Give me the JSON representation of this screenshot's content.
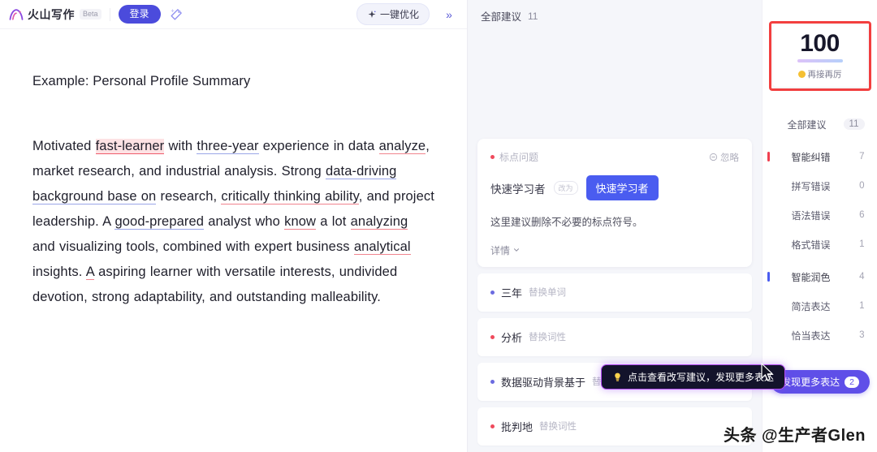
{
  "header": {
    "logo_text": "火山写作",
    "beta_label": "Beta",
    "login_label": "登录",
    "wand_icon": "magic-wand-icon",
    "optimize_label": "一键优化",
    "optimize_icon": "sparkle-icon",
    "collapse_label": "»"
  },
  "editor": {
    "title": "Example: Personal Profile Summary",
    "paragraph_segments": [
      {
        "text": "Motivated ",
        "mark": "none"
      },
      {
        "text": "fast-learner",
        "mark": "error-highlight"
      },
      {
        "text": " with ",
        "mark": "none"
      },
      {
        "text": "three-year",
        "mark": "polish"
      },
      {
        "text": " experience in data ",
        "mark": "none"
      },
      {
        "text": "analyze",
        "mark": "error"
      },
      {
        "text": ", market research, and industrial analysis. Strong ",
        "mark": "none"
      },
      {
        "text": "data-driving background base on",
        "mark": "polish"
      },
      {
        "text": " research, ",
        "mark": "none"
      },
      {
        "text": "critically thinking ability",
        "mark": "error"
      },
      {
        "text": ", and project leadership. A ",
        "mark": "none"
      },
      {
        "text": "good-prepared",
        "mark": "polish"
      },
      {
        "text": " analyst who ",
        "mark": "none"
      },
      {
        "text": "know",
        "mark": "error"
      },
      {
        "text": " a lot ",
        "mark": "none"
      },
      {
        "text": "analyzing",
        "mark": "error"
      },
      {
        "text": " and visualizing tools, combined with expert business ",
        "mark": "none"
      },
      {
        "text": "analytical",
        "mark": "error"
      },
      {
        "text": " insights. ",
        "mark": "none"
      },
      {
        "text": "A",
        "mark": "error"
      },
      {
        "text": " aspiring learner with versatile interests, undivided devotion, strong adaptability, and outstanding malleability.",
        "mark": "none"
      }
    ]
  },
  "suggestions": {
    "header_label": "全部建议",
    "header_count": "11",
    "card": {
      "type_label": "标点问题",
      "ignore_label": "忽略",
      "ignore_icon": "minus-circle-icon",
      "old_text": "快速学习者",
      "arrow_label": "改为",
      "new_text": "快速学习者",
      "description": "这里建议删除不必要的标点符号。",
      "more_label": "详情",
      "more_icon": "chevron-down-icon"
    },
    "rows": [
      {
        "word": "三年",
        "tag": "替换单词",
        "dot": "blue"
      },
      {
        "word": "分析",
        "tag": "替换词性",
        "dot": "red"
      },
      {
        "word": "数据驱动背景基于",
        "tag": "替换词性",
        "dot": "blue"
      },
      {
        "word": "批判地",
        "tag": "替换词性",
        "dot": "red"
      }
    ]
  },
  "tooltip": {
    "icon": "lightbulb-icon",
    "text": "点击查看改写建议，发现更多表达"
  },
  "score": {
    "value": "100",
    "subtitle": "再接再厉",
    "emoji": "smiley-face-icon"
  },
  "categories": [
    {
      "label": "全部建议",
      "count": "11",
      "marker": "none",
      "style": "pill",
      "group": false
    },
    {
      "label": "智能纠错",
      "count": "7",
      "marker": "red",
      "style": "plain",
      "group": true
    },
    {
      "label": "拼写错误",
      "count": "0",
      "marker": "none",
      "style": "plain",
      "group": false
    },
    {
      "label": "语法错误",
      "count": "6",
      "marker": "none",
      "style": "plain",
      "group": false
    },
    {
      "label": "格式错误",
      "count": "1",
      "marker": "none",
      "style": "plain",
      "group": false
    },
    {
      "label": "智能润色",
      "count": "4",
      "marker": "blue",
      "style": "plain",
      "group": true
    },
    {
      "label": "简洁表达",
      "count": "1",
      "marker": "none",
      "style": "plain",
      "group": false
    },
    {
      "label": "恰当表达",
      "count": "3",
      "marker": "none",
      "style": "plain",
      "group": false
    }
  ],
  "discover": {
    "label": "发现更多表达",
    "count": "2"
  },
  "watermark": "头条 @生产者Glen",
  "colors": {
    "brand_purple": "#4b4bdc",
    "error_red": "#ef4a5c",
    "polish_blue": "#4a5cf0",
    "highlight_box": "#f33f3f"
  }
}
